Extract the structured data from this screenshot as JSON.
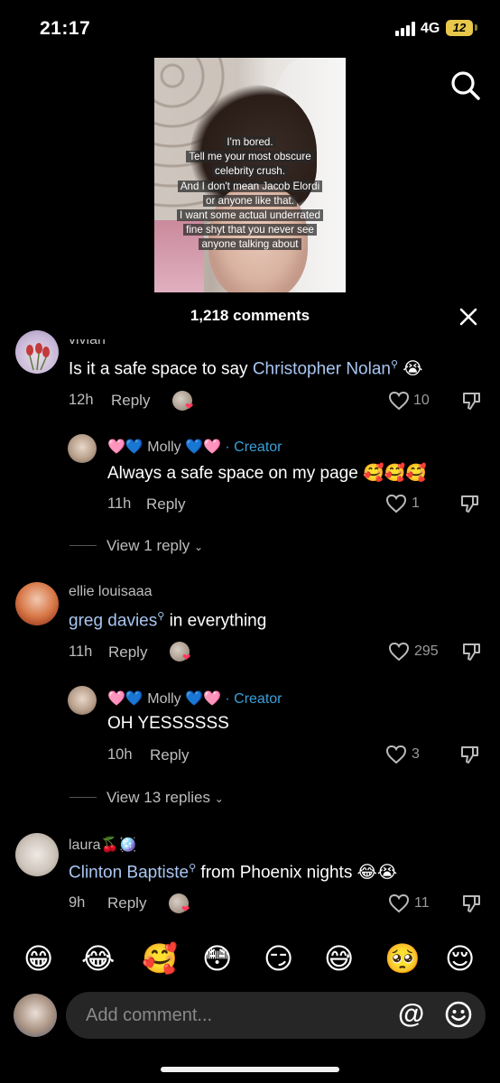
{
  "status_bar": {
    "time": "21:17",
    "network": "4G",
    "battery": "12"
  },
  "video": {
    "overlay_lines": [
      "I'm bored.",
      "Tell me your most obscure",
      "celebrity crush.",
      "And I don't mean Jacob Elordi",
      "or anyone like that.",
      "I want some actual underrated",
      "fine shyt that you never see",
      "anyone talking about"
    ]
  },
  "header": {
    "comments_count": "1,218 comments"
  },
  "comments": [
    {
      "username": "vivian",
      "text_link": "Christopher Nolan",
      "text_pre": "Is it a safe space to say ",
      "text_post": " 😭",
      "time": "12h",
      "reply_label": "Reply",
      "likes": "10",
      "reply": {
        "username": "🩷💙 Molly 💙🩷",
        "creator_label": "· Creator",
        "text": "Always a safe space on my page 🥰🥰🥰",
        "time": "11h",
        "reply_label": "Reply",
        "likes": "1"
      },
      "view_replies": "View 1 reply"
    },
    {
      "username": "ellie louisaaa",
      "text_link": "greg davies",
      "text_pre": "",
      "text_post": " in everything",
      "time": "11h",
      "reply_label": "Reply",
      "likes": "295",
      "reply": {
        "username": "🩷💙 Molly 💙🩷",
        "creator_label": "· Creator",
        "text": "OH YESSSSSS",
        "time": "10h",
        "reply_label": "Reply",
        "likes": "3"
      },
      "view_replies": "View 13 replies"
    },
    {
      "username": "laura🍒🪩",
      "text_link": "Clinton Baptiste",
      "text_pre": "",
      "text_post": " from Phoenix nights 😂😭",
      "time": "9h",
      "reply_label": "Reply",
      "likes": "11"
    }
  ],
  "emoji_bar": [
    "😁",
    "😂",
    "🥰",
    "😳",
    "😏",
    "😅",
    "🥺",
    "😌"
  ],
  "input": {
    "placeholder": "Add comment...",
    "at_symbol": "@"
  },
  "colors": {
    "background": "#000000",
    "link": "#a9c6f2",
    "creator": "#3aa0d9",
    "heart": "#ff3a5c"
  }
}
